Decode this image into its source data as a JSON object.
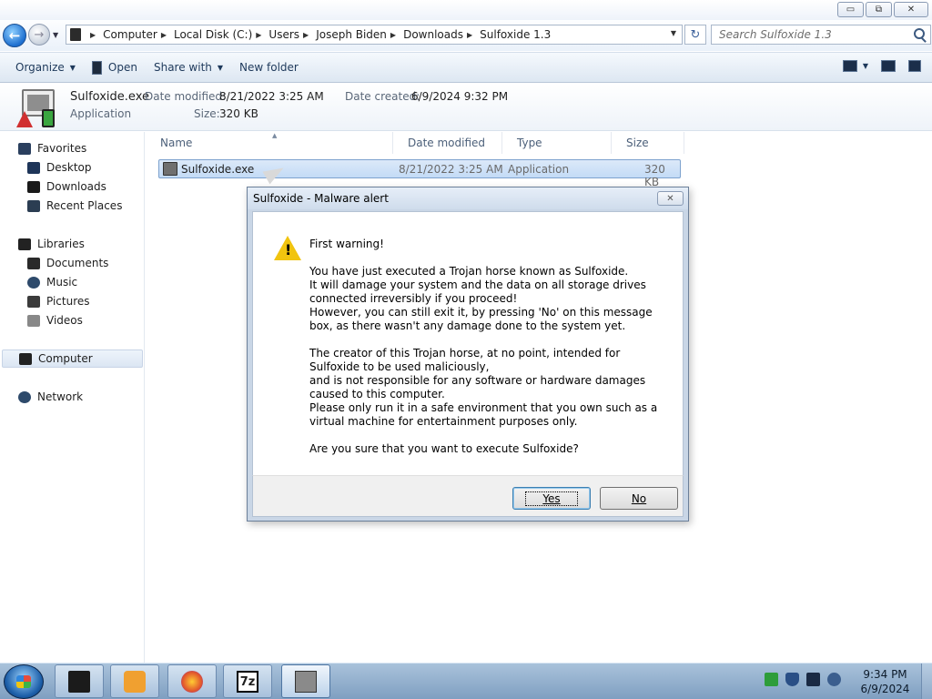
{
  "window": {
    "caption_buttons": {
      "minimize": "▭",
      "maximize": "⧉",
      "close": "✕"
    }
  },
  "address": {
    "crumbs": [
      "Computer",
      "Local Disk (C:)",
      "Users",
      "Joseph Biden",
      "Downloads",
      "Sulfoxide 1.3"
    ],
    "search_placeholder": "Search Sulfoxide 1.3"
  },
  "commands": {
    "organize": "Organize",
    "open": "Open",
    "share_with": "Share with",
    "new_folder": "New folder"
  },
  "details": {
    "name": "Sulfoxide.exe",
    "type": "Application",
    "date_modified_label": "Date modified:",
    "date_modified": "8/21/2022 3:25 AM",
    "date_created_label": "Date created:",
    "date_created": "6/9/2024 9:32 PM",
    "size_label": "Size:",
    "size": "320 KB"
  },
  "nav": {
    "favorites": "Favorites",
    "desktop": "Desktop",
    "downloads": "Downloads",
    "recent_places": "Recent Places",
    "libraries": "Libraries",
    "documents": "Documents",
    "music": "Music",
    "pictures": "Pictures",
    "videos": "Videos",
    "computer": "Computer",
    "network": "Network"
  },
  "list": {
    "columns": {
      "name": "Name",
      "date_modified": "Date modified",
      "type": "Type",
      "size": "Size"
    },
    "rows": [
      {
        "name": "Sulfoxide.exe",
        "date_modified": "8/21/2022 3:25 AM",
        "type": "Application",
        "size": "320 KB"
      }
    ]
  },
  "dialog": {
    "title": "Sulfoxide - Malware alert",
    "close_glyph": "✕",
    "paragraphs": [
      "First warning!",
      "You have just executed a Trojan horse known as Sulfoxide.\nIt will damage your system and the data on all storage drives connected irreversibly if you proceed!\nHowever, you can still exit it, by pressing 'No' on this message box, as there wasn't any damage done to the system yet.",
      "The creator of this Trojan horse, at no point, intended for Sulfoxide to be used maliciously,\nand is not responsible for any software or hardware damages caused to this computer.\nPlease only run it in a safe environment that you own such as a virtual machine for entertainment purposes only.",
      "Are you sure that you want to execute Sulfoxide?"
    ],
    "yes_label": "Yes",
    "no_label": "No"
  },
  "taskbar": {
    "clock_time": "9:34 PM",
    "clock_date": "6/9/2024"
  },
  "colors": {
    "selection": "#cde3fa",
    "taskbar": "#8fadcd",
    "warning": "#f1c40f"
  }
}
